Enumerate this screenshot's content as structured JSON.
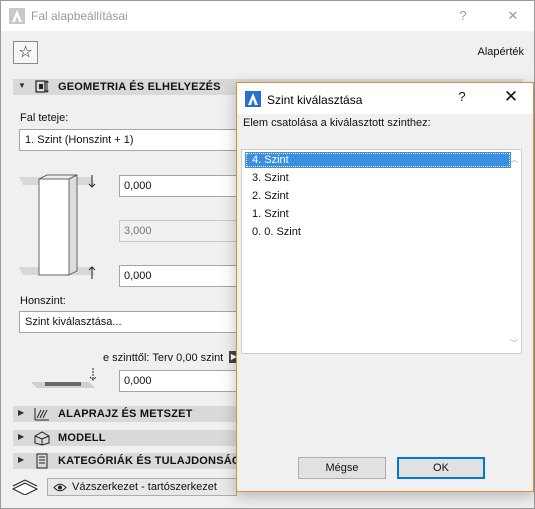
{
  "main": {
    "title": "Fal alapbeállításai",
    "help_glyph": "?",
    "close_glyph": "✕",
    "favorites_glyph": "☆",
    "default_label": "Alapérték",
    "sections": {
      "geometry": "GEOMETRIA ÉS ELHELYEZÉS",
      "floorplan": "ALAPRAJZ ÉS METSZET",
      "model": "MODELL",
      "categories": "KATEGÓRIÁK ÉS TULAJDONSÁGOK"
    },
    "top_label": "Fal teteje:",
    "top_value": "1. Szint (Honszint + 1)",
    "height_top": "0,000",
    "height_total": "3,000",
    "height_bottom": "0,000",
    "home_story_label": "Honszint:",
    "home_story_value": "Szint kiválasztása...",
    "offset_label": "e szinttől: Terv 0,00 szint",
    "offset_value": "0,000",
    "structure_value": "Vázszerkezet - tartószerkezet"
  },
  "dialog": {
    "title": "Szint kiválasztása",
    "help_glyph": "?",
    "close_glyph": "✕",
    "prompt": "Elem csatolása a kiválasztott szinthez:",
    "items": [
      "4. Szint",
      "3. Szint",
      "2. Szint",
      "1. Szint",
      "0. 0. Szint"
    ],
    "selected_index": 0,
    "cancel_label": "Mégse",
    "ok_label": "OK"
  },
  "colors": {
    "dialog_border": "#e88b2f",
    "selection": "#3b8fe0",
    "app_icon": "#2a6fd0"
  }
}
